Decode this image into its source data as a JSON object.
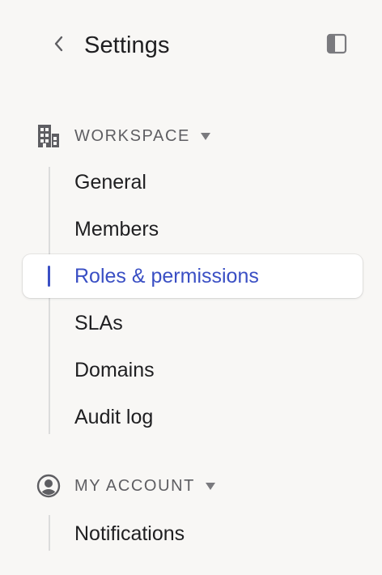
{
  "header": {
    "title": "Settings",
    "back_icon": "chevron-left-icon",
    "toggle_icon": "sidebar-toggle-icon"
  },
  "sections": [
    {
      "label": "WORKSPACE",
      "icon": "building-icon",
      "expanded": true,
      "items": [
        {
          "label": "General",
          "active": false
        },
        {
          "label": "Members",
          "active": false
        },
        {
          "label": "Roles & permissions",
          "active": true
        },
        {
          "label": "SLAs",
          "active": false
        },
        {
          "label": "Domains",
          "active": false
        },
        {
          "label": "Audit log",
          "active": false
        }
      ]
    },
    {
      "label": "MY ACCOUNT",
      "icon": "user-circle-icon",
      "expanded": true,
      "items": [
        {
          "label": "Notifications",
          "active": false
        }
      ]
    }
  ],
  "colors": {
    "accent": "#3a4fc4",
    "background": "#f8f7f5",
    "text": "#1f1f21",
    "muted": "#5e5e62"
  }
}
